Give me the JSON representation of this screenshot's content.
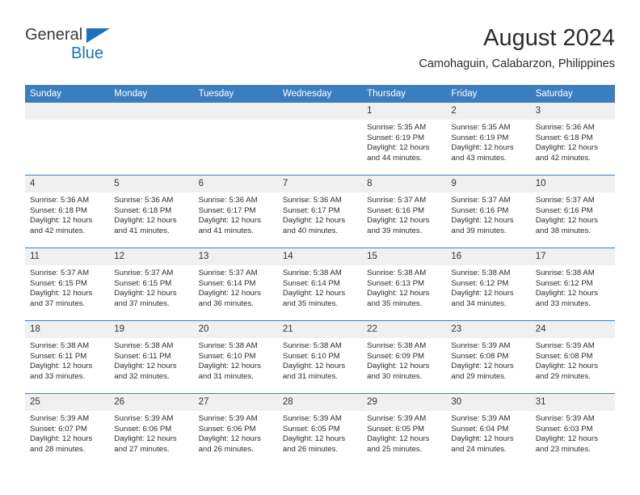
{
  "brand": {
    "line1": "General",
    "line2": "Blue",
    "accent_color": "#1c72bd"
  },
  "header": {
    "title": "August 2024",
    "subtitle": "Camohaguin, Calabarzon, Philippines"
  },
  "theme": {
    "header_blue": "#3a7ebf",
    "daynum_band": "#f0f0f0",
    "text": "#2d2d2d"
  },
  "weekdays": [
    "Sunday",
    "Monday",
    "Tuesday",
    "Wednesday",
    "Thursday",
    "Friday",
    "Saturday"
  ],
  "weeks": [
    [
      {
        "day": "",
        "sunrise": "",
        "sunset": "",
        "daylight_1": "",
        "daylight_2": ""
      },
      {
        "day": "",
        "sunrise": "",
        "sunset": "",
        "daylight_1": "",
        "daylight_2": ""
      },
      {
        "day": "",
        "sunrise": "",
        "sunset": "",
        "daylight_1": "",
        "daylight_2": ""
      },
      {
        "day": "",
        "sunrise": "",
        "sunset": "",
        "daylight_1": "",
        "daylight_2": ""
      },
      {
        "day": "1",
        "sunrise": "Sunrise: 5:35 AM",
        "sunset": "Sunset: 6:19 PM",
        "daylight_1": "Daylight: 12 hours",
        "daylight_2": "and 44 minutes."
      },
      {
        "day": "2",
        "sunrise": "Sunrise: 5:35 AM",
        "sunset": "Sunset: 6:19 PM",
        "daylight_1": "Daylight: 12 hours",
        "daylight_2": "and 43 minutes."
      },
      {
        "day": "3",
        "sunrise": "Sunrise: 5:36 AM",
        "sunset": "Sunset: 6:18 PM",
        "daylight_1": "Daylight: 12 hours",
        "daylight_2": "and 42 minutes."
      }
    ],
    [
      {
        "day": "4",
        "sunrise": "Sunrise: 5:36 AM",
        "sunset": "Sunset: 6:18 PM",
        "daylight_1": "Daylight: 12 hours",
        "daylight_2": "and 42 minutes."
      },
      {
        "day": "5",
        "sunrise": "Sunrise: 5:36 AM",
        "sunset": "Sunset: 6:18 PM",
        "daylight_1": "Daylight: 12 hours",
        "daylight_2": "and 41 minutes."
      },
      {
        "day": "6",
        "sunrise": "Sunrise: 5:36 AM",
        "sunset": "Sunset: 6:17 PM",
        "daylight_1": "Daylight: 12 hours",
        "daylight_2": "and 41 minutes."
      },
      {
        "day": "7",
        "sunrise": "Sunrise: 5:36 AM",
        "sunset": "Sunset: 6:17 PM",
        "daylight_1": "Daylight: 12 hours",
        "daylight_2": "and 40 minutes."
      },
      {
        "day": "8",
        "sunrise": "Sunrise: 5:37 AM",
        "sunset": "Sunset: 6:16 PM",
        "daylight_1": "Daylight: 12 hours",
        "daylight_2": "and 39 minutes."
      },
      {
        "day": "9",
        "sunrise": "Sunrise: 5:37 AM",
        "sunset": "Sunset: 6:16 PM",
        "daylight_1": "Daylight: 12 hours",
        "daylight_2": "and 39 minutes."
      },
      {
        "day": "10",
        "sunrise": "Sunrise: 5:37 AM",
        "sunset": "Sunset: 6:16 PM",
        "daylight_1": "Daylight: 12 hours",
        "daylight_2": "and 38 minutes."
      }
    ],
    [
      {
        "day": "11",
        "sunrise": "Sunrise: 5:37 AM",
        "sunset": "Sunset: 6:15 PM",
        "daylight_1": "Daylight: 12 hours",
        "daylight_2": "and 37 minutes."
      },
      {
        "day": "12",
        "sunrise": "Sunrise: 5:37 AM",
        "sunset": "Sunset: 6:15 PM",
        "daylight_1": "Daylight: 12 hours",
        "daylight_2": "and 37 minutes."
      },
      {
        "day": "13",
        "sunrise": "Sunrise: 5:37 AM",
        "sunset": "Sunset: 6:14 PM",
        "daylight_1": "Daylight: 12 hours",
        "daylight_2": "and 36 minutes."
      },
      {
        "day": "14",
        "sunrise": "Sunrise: 5:38 AM",
        "sunset": "Sunset: 6:14 PM",
        "daylight_1": "Daylight: 12 hours",
        "daylight_2": "and 35 minutes."
      },
      {
        "day": "15",
        "sunrise": "Sunrise: 5:38 AM",
        "sunset": "Sunset: 6:13 PM",
        "daylight_1": "Daylight: 12 hours",
        "daylight_2": "and 35 minutes."
      },
      {
        "day": "16",
        "sunrise": "Sunrise: 5:38 AM",
        "sunset": "Sunset: 6:12 PM",
        "daylight_1": "Daylight: 12 hours",
        "daylight_2": "and 34 minutes."
      },
      {
        "day": "17",
        "sunrise": "Sunrise: 5:38 AM",
        "sunset": "Sunset: 6:12 PM",
        "daylight_1": "Daylight: 12 hours",
        "daylight_2": "and 33 minutes."
      }
    ],
    [
      {
        "day": "18",
        "sunrise": "Sunrise: 5:38 AM",
        "sunset": "Sunset: 6:11 PM",
        "daylight_1": "Daylight: 12 hours",
        "daylight_2": "and 33 minutes."
      },
      {
        "day": "19",
        "sunrise": "Sunrise: 5:38 AM",
        "sunset": "Sunset: 6:11 PM",
        "daylight_1": "Daylight: 12 hours",
        "daylight_2": "and 32 minutes."
      },
      {
        "day": "20",
        "sunrise": "Sunrise: 5:38 AM",
        "sunset": "Sunset: 6:10 PM",
        "daylight_1": "Daylight: 12 hours",
        "daylight_2": "and 31 minutes."
      },
      {
        "day": "21",
        "sunrise": "Sunrise: 5:38 AM",
        "sunset": "Sunset: 6:10 PM",
        "daylight_1": "Daylight: 12 hours",
        "daylight_2": "and 31 minutes."
      },
      {
        "day": "22",
        "sunrise": "Sunrise: 5:38 AM",
        "sunset": "Sunset: 6:09 PM",
        "daylight_1": "Daylight: 12 hours",
        "daylight_2": "and 30 minutes."
      },
      {
        "day": "23",
        "sunrise": "Sunrise: 5:39 AM",
        "sunset": "Sunset: 6:08 PM",
        "daylight_1": "Daylight: 12 hours",
        "daylight_2": "and 29 minutes."
      },
      {
        "day": "24",
        "sunrise": "Sunrise: 5:39 AM",
        "sunset": "Sunset: 6:08 PM",
        "daylight_1": "Daylight: 12 hours",
        "daylight_2": "and 29 minutes."
      }
    ],
    [
      {
        "day": "25",
        "sunrise": "Sunrise: 5:39 AM",
        "sunset": "Sunset: 6:07 PM",
        "daylight_1": "Daylight: 12 hours",
        "daylight_2": "and 28 minutes."
      },
      {
        "day": "26",
        "sunrise": "Sunrise: 5:39 AM",
        "sunset": "Sunset: 6:06 PM",
        "daylight_1": "Daylight: 12 hours",
        "daylight_2": "and 27 minutes."
      },
      {
        "day": "27",
        "sunrise": "Sunrise: 5:39 AM",
        "sunset": "Sunset: 6:06 PM",
        "daylight_1": "Daylight: 12 hours",
        "daylight_2": "and 26 minutes."
      },
      {
        "day": "28",
        "sunrise": "Sunrise: 5:39 AM",
        "sunset": "Sunset: 6:05 PM",
        "daylight_1": "Daylight: 12 hours",
        "daylight_2": "and 26 minutes."
      },
      {
        "day": "29",
        "sunrise": "Sunrise: 5:39 AM",
        "sunset": "Sunset: 6:05 PM",
        "daylight_1": "Daylight: 12 hours",
        "daylight_2": "and 25 minutes."
      },
      {
        "day": "30",
        "sunrise": "Sunrise: 5:39 AM",
        "sunset": "Sunset: 6:04 PM",
        "daylight_1": "Daylight: 12 hours",
        "daylight_2": "and 24 minutes."
      },
      {
        "day": "31",
        "sunrise": "Sunrise: 5:39 AM",
        "sunset": "Sunset: 6:03 PM",
        "daylight_1": "Daylight: 12 hours",
        "daylight_2": "and 23 minutes."
      }
    ]
  ]
}
